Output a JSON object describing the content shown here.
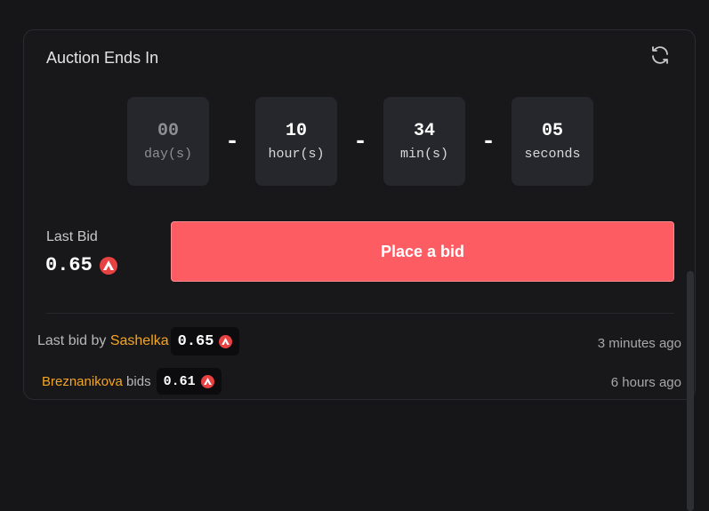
{
  "auction": {
    "title": "Auction Ends In",
    "countdown": [
      {
        "value": "00",
        "unit": "day(s)",
        "dim": true
      },
      {
        "value": "10",
        "unit": "hour(s)",
        "dim": false
      },
      {
        "value": "34",
        "unit": "min(s)",
        "dim": false
      },
      {
        "value": "05",
        "unit": "seconds",
        "dim": false
      }
    ],
    "separator": "-",
    "last_bid_label": "Last Bid",
    "last_bid_value": "0.65",
    "place_bid_label": "Place a bid"
  },
  "history": [
    {
      "prefix": "Last bid by ",
      "user": "Sashelka",
      "suffix": "",
      "amount": "0.65",
      "time": "3 minutes ago"
    },
    {
      "prefix": "",
      "user": "Breznanikova",
      "suffix": " bids",
      "amount": "0.61",
      "time": "6 hours ago"
    }
  ],
  "colors": {
    "accent": "#fd5c63",
    "username": "#f5a623",
    "avax": "#e84142",
    "background": "#161618"
  },
  "icons": {
    "refresh": "refresh-icon",
    "currency": "avax-icon"
  }
}
